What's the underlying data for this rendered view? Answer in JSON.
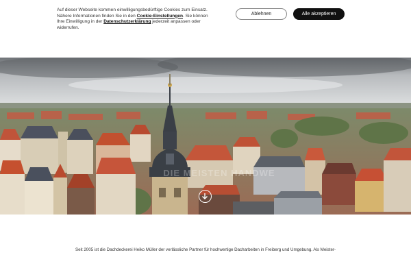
{
  "cookie_banner": {
    "line1": "Auf dieser Webseite kommen einwilligungsbedürftige Cookies zum Einsatz.",
    "line2_pre": "Nähere Informationen finden Sie in den ",
    "settings_link": "Cookie-Einstellungen",
    "line2_mid": ". Sie können Ihre Einwilligung in der ",
    "privacy_link": "Datenschutzerklärung",
    "line2_post": " jederzeit anpassen oder widerrufen.",
    "decline_label": "Ablehnen",
    "accept_label": "Alle akzeptieren"
  },
  "hero": {
    "tagline": "DIE MEISTEN HANDWE",
    "scroll_icon": "arrow-down-circle-icon",
    "colors": {
      "sky": "#c9ccce",
      "roof": "#c8553a",
      "tower": "#3a3f46"
    }
  },
  "intro": {
    "text": "Seit 2005 ist die Dachdeckerei Heiko Müller der verlässliche Partner für hochwertige Dacharbeiten in Freiberg und Umgebung. Als Meister-"
  }
}
